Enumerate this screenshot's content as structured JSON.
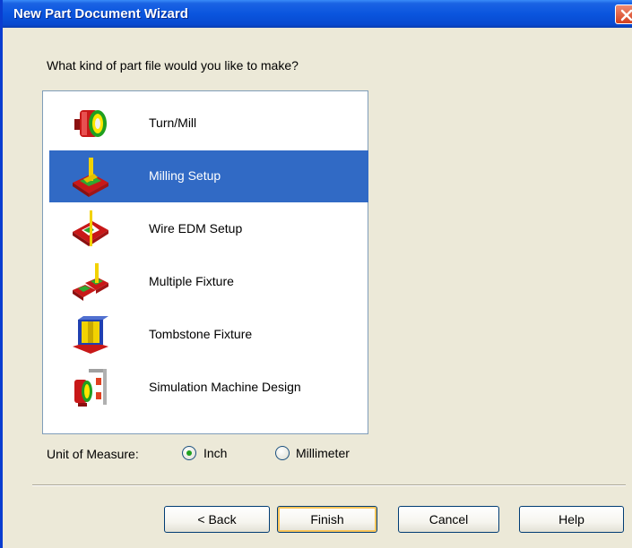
{
  "window": {
    "title": "New Part Document Wizard"
  },
  "prompt": "What kind of part file would you like to make?",
  "part_types": [
    {
      "label": "Turn/Mill",
      "icon": "turn-mill-icon",
      "selected": false
    },
    {
      "label": "Milling Setup",
      "icon": "milling-setup-icon",
      "selected": true
    },
    {
      "label": "Wire EDM Setup",
      "icon": "wire-edm-icon",
      "selected": false
    },
    {
      "label": "Multiple Fixture",
      "icon": "multiple-fixture-icon",
      "selected": false
    },
    {
      "label": "Tombstone Fixture",
      "icon": "tombstone-fixture-icon",
      "selected": false
    },
    {
      "label": "Simulation Machine Design",
      "icon": "simulation-machine-icon",
      "selected": false
    }
  ],
  "unit_of_measure": {
    "label": "Unit of Measure:",
    "options": [
      {
        "label": "Inch",
        "checked": true
      },
      {
        "label": "Millimeter",
        "checked": false
      }
    ]
  },
  "buttons": {
    "back": "< Back",
    "finish": "Finish",
    "cancel": "Cancel",
    "help": "Help"
  },
  "colors": {
    "title_bar": "#0A55DE",
    "selection": "#316AC5",
    "dialog_bg": "#ECE9D8"
  }
}
